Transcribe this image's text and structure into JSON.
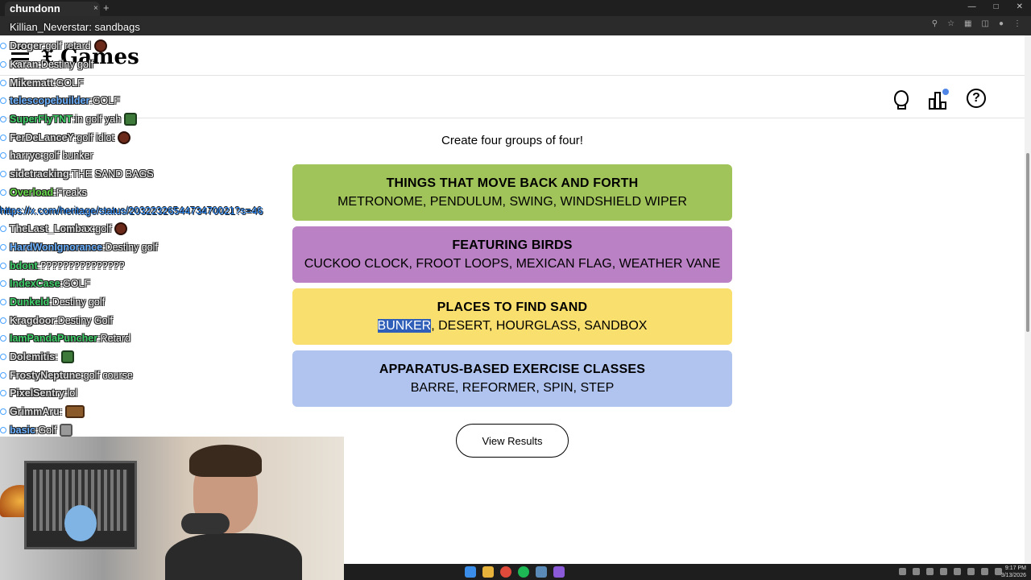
{
  "browser": {
    "tab_title": "chundonn",
    "new_tab": "+",
    "close_tab": "×"
  },
  "site": {
    "logo": "Games"
  },
  "game": {
    "subtitle": "Create four groups of four!",
    "groups": [
      {
        "title": "THINGS THAT MOVE BACK AND FORTH",
        "words": "METRONOME, PENDULUM, SWING, WINDSHIELD WIPER",
        "color": "#a0c35a"
      },
      {
        "title": "FEATURING BIRDS",
        "words": "CUCKOO CLOCK, FROOT LOOPS, MEXICAN FLAG, WEATHER VANE",
        "color": "#ba81c5"
      },
      {
        "title": "PLACES TO FIND SAND",
        "words_selected": "BUNKER",
        "words_rest": ", DESERT, HOURGLASS, SANDBOX",
        "color": "#f9df6d"
      },
      {
        "title": "APPARATUS-BASED EXERCISE CLASSES",
        "words": "BARRE, REFORMER, SPIN, STEP",
        "color": "#b0c4ef"
      }
    ],
    "view_results_label": "View Results",
    "help_symbol": "?"
  },
  "chat": {
    "header_user": "chundonn",
    "sub_message": "Killian_Neverstar: sandbags",
    "lines": [
      {
        "user": "Droger",
        "color": "#dddddd",
        "msg": "golf retard",
        "emote": "red"
      },
      {
        "user": "Karan",
        "color": "#dddddd",
        "msg": "Destiny golf"
      },
      {
        "user": "Mikematt",
        "color": "#dddddd",
        "msg": "GOLF"
      },
      {
        "user": "telescopebuilder",
        "color": "#6ab0ff",
        "msg": "GOLF"
      },
      {
        "user": "SuperFlyTNT",
        "color": "#3fd06a",
        "msg": "in golf yah",
        "emote": "green"
      },
      {
        "user": "FerDeLanceY",
        "color": "#dddddd",
        "msg": "golf idiot",
        "emote": "red"
      },
      {
        "user": "harryc",
        "color": "#dddddd",
        "msg": "golf bunker"
      },
      {
        "user": "sidetracking",
        "color": "#dddddd",
        "msg": "THE SAND BAGS"
      },
      {
        "user": "Overload",
        "color": "#66d94a",
        "msg": "Freaks"
      },
      {
        "user": "",
        "color": "#2a8cff",
        "msg": "https://x.com/heritage/status/2032232654473470021?s=46",
        "link": true
      },
      {
        "user": "TheLast_Lombax",
        "color": "#dddddd",
        "msg": "golf",
        "emote": "red"
      },
      {
        "user": "HardWonIgnorance",
        "color": "#6ab0ff",
        "msg": "Destiny golf"
      },
      {
        "user": "bdont",
        "color": "#3fd06a",
        "msg": "???????????????"
      },
      {
        "user": "IndexCase",
        "color": "#3fd06a",
        "msg": "GOLF"
      },
      {
        "user": "Dunkeld",
        "color": "#3fd06a",
        "msg": "Destiny golf"
      },
      {
        "user": "Kragdoor",
        "color": "#dddddd",
        "msg": "Destiny Golf"
      },
      {
        "user": "IamPandaPuncher",
        "color": "#3fd06a",
        "msg": "Retard"
      },
      {
        "user": "Dolemitis",
        "color": "#dddddd",
        "msg": "",
        "emote": "green"
      },
      {
        "user": "FrostyNeptune",
        "color": "#dddddd",
        "msg": "golf course"
      },
      {
        "user": "PixelSentry",
        "color": "#dddddd",
        "msg": "lol"
      },
      {
        "user": "GrimmAru",
        "color": "#dddddd",
        "msg": "",
        "emote": "wide"
      },
      {
        "user": "basic",
        "color": "#6ab0ff",
        "msg": "Golf",
        "emote": "grey"
      }
    ]
  },
  "taskbar": {
    "time": "9:17 PM",
    "date": "3/13/2026"
  }
}
